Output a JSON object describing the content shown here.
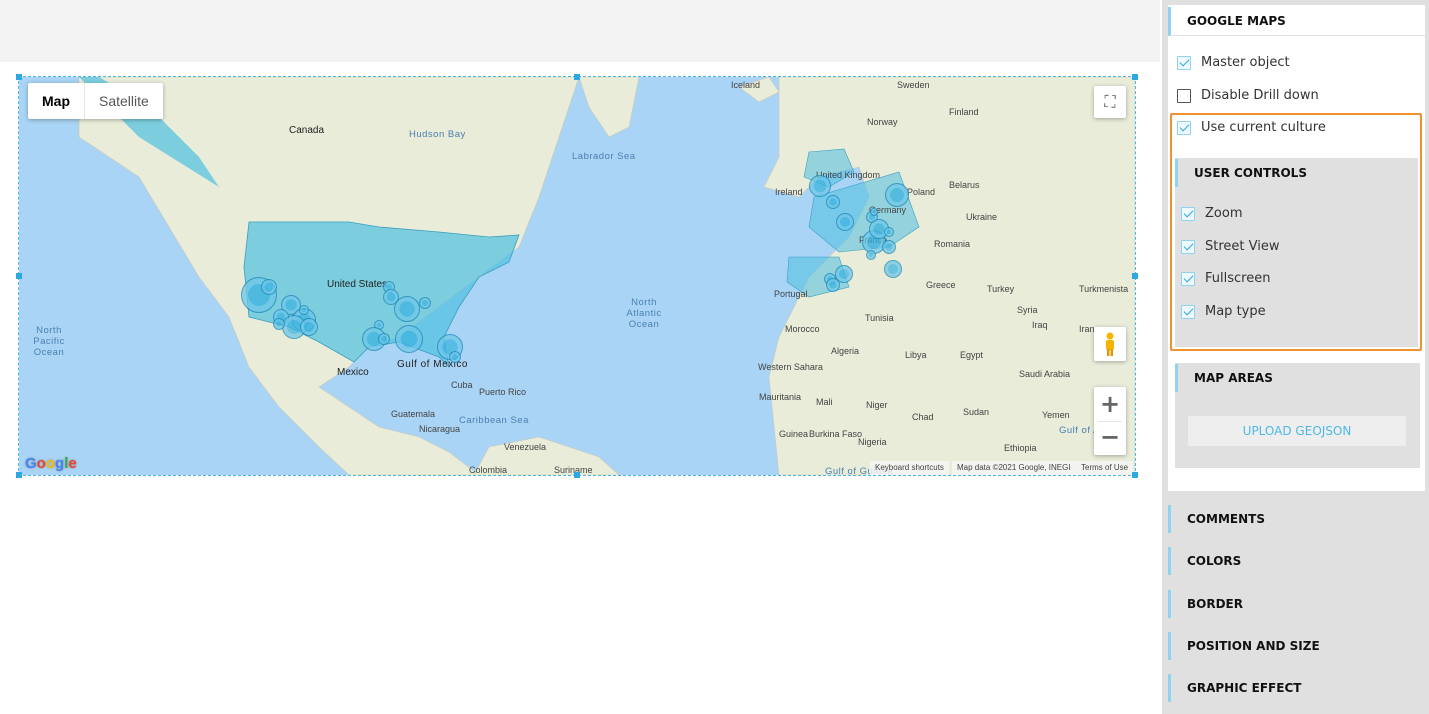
{
  "map": {
    "map_type_options": [
      "Map",
      "Satellite"
    ],
    "selected_map_type": "Map",
    "attribution": {
      "keyboard": "Keyboard shortcuts",
      "data": "Map data ©2021 Google, INEGI",
      "terms": "Terms of Use"
    },
    "logo": "Google",
    "labels": [
      "Iceland",
      "Sweden",
      "Finland",
      "Norway",
      "Canada",
      "Hudson Bay",
      "Labrador Sea",
      "Ireland",
      "United Kingdom",
      "Poland",
      "Belarus",
      "Ukraine",
      "Germany",
      "France",
      "Romania",
      "Portugal",
      "Greece",
      "Turkey",
      "Turkmenista",
      "Syria",
      "Iraq",
      "Iran",
      "United States",
      "North Atlantic Ocean",
      "Morocco",
      "Tunisia",
      "Algeria",
      "Libya",
      "Egypt",
      "Saudi Arabia",
      "Mexico",
      "Gulf of Mexico",
      "Cuba",
      "Puerto Rico",
      "Western Sahara",
      "Mauritania",
      "Mali",
      "Niger",
      "Chad",
      "Sudan",
      "Yemen",
      "Gulf of Aden",
      "Guatemala",
      "Nicaragua",
      "Caribbean Sea",
      "Venezuela",
      "Colombia",
      "Suriname",
      "Nigeria",
      "Ethiopia",
      "Burkina Faso",
      "Guinea",
      "Gulf of Guinea",
      "North Pacific Ocean"
    ],
    "marker_color": "#3fb4e0",
    "area_color": "#4fc0e0"
  },
  "panel": {
    "title": "GOOGLE MAPS",
    "options": [
      {
        "label": "Master object",
        "checked": true
      },
      {
        "label": "Disable Drill down",
        "checked": false
      },
      {
        "label": "Use current culture",
        "checked": true
      }
    ],
    "user_controls": {
      "title": "USER CONTROLS",
      "items": [
        {
          "label": "Zoom",
          "checked": true
        },
        {
          "label": "Street View",
          "checked": true
        },
        {
          "label": "Fullscreen",
          "checked": true
        },
        {
          "label": "Map type",
          "checked": true
        }
      ]
    },
    "map_areas": {
      "title": "MAP AREAS",
      "upload_label": "UPLOAD GEOJSON"
    },
    "sections": [
      "COMMENTS",
      "COLORS",
      "BORDER",
      "POSITION AND SIZE",
      "GRAPHIC EFFECT"
    ],
    "highlight_color": "#f0922e",
    "accent_color": "#8fd3ee"
  }
}
